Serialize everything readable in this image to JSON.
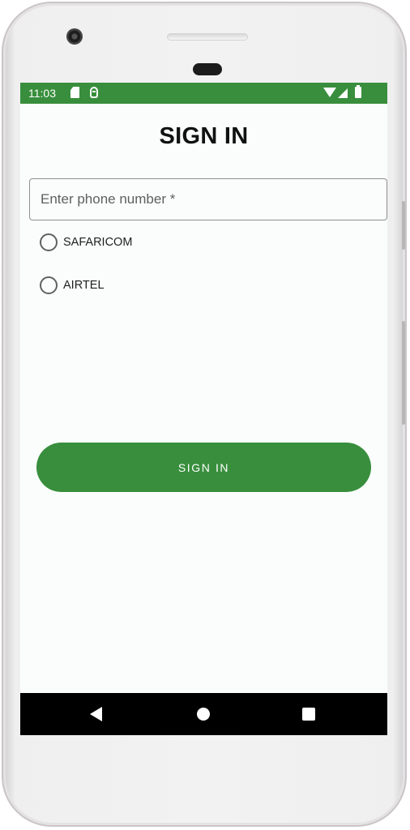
{
  "status_bar": {
    "time": "11:03",
    "background_color": "#388e3c",
    "icons": [
      "sd-card-icon",
      "database-icon",
      "wifi-icon",
      "signal-icon",
      "battery-icon"
    ]
  },
  "page": {
    "title": "SIGN IN"
  },
  "form": {
    "phone_input": {
      "placeholder": "Enter phone number *",
      "value": ""
    },
    "network_options": [
      {
        "label": "SAFARICOM",
        "selected": false
      },
      {
        "label": "AIRTEL",
        "selected": false
      }
    ],
    "submit_label": "SIGN IN",
    "accent_color": "#388e3c"
  },
  "nav_bar": {
    "icons": [
      "back-icon",
      "home-icon",
      "recents-icon"
    ]
  }
}
